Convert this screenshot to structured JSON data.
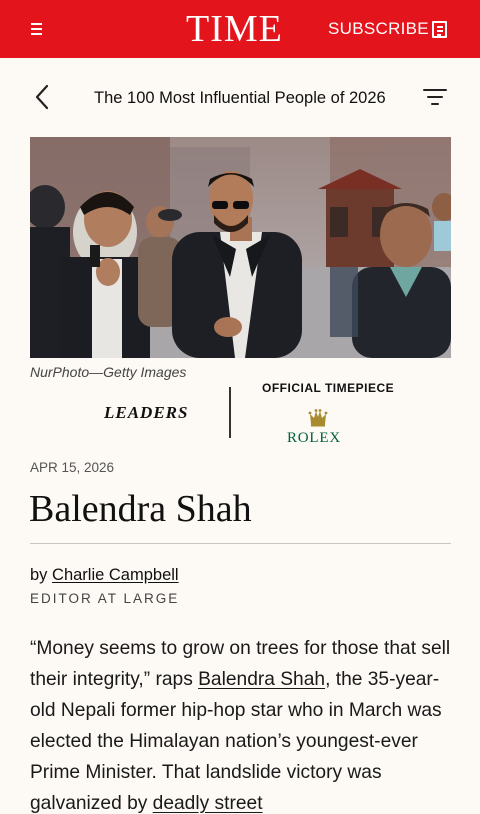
{
  "header": {
    "logo": "TIME",
    "subscribe_label": "SUBSCRIBE",
    "brand_color": "#e4141c"
  },
  "nav": {
    "list_title": "The 100 Most Influential People of 2026"
  },
  "photo": {
    "credit": "NurPhoto—Getty Images"
  },
  "sponsor": {
    "category": "LEADERS",
    "timepiece_label": "OFFICIAL TIMEPIECE",
    "brand": "ROLEX",
    "brand_color": "#006039"
  },
  "article": {
    "date": "APR 15, 2026",
    "headline": "Balendra Shah",
    "by_prefix": "by",
    "author": "Charlie Campbell",
    "author_role": "EDITOR AT LARGE",
    "p1_a": "“Money seems to grow on trees for those that sell their integrity,” raps ",
    "p1_link1": "Balendra Shah",
    "p1_b": ", the 35-year-old Nepali former hip-hop star who in March was elected the Himalayan nation’s youngest-ever Prime Minister. That landslide victory was galvanized by ",
    "p1_link2": "deadly street"
  },
  "icons": {
    "menu": "hamburger-menu-icon",
    "subscribe": "newspaper-icon",
    "back": "chevron-left-icon",
    "filter": "filter-lines-icon",
    "crown": "rolex-crown-icon"
  }
}
